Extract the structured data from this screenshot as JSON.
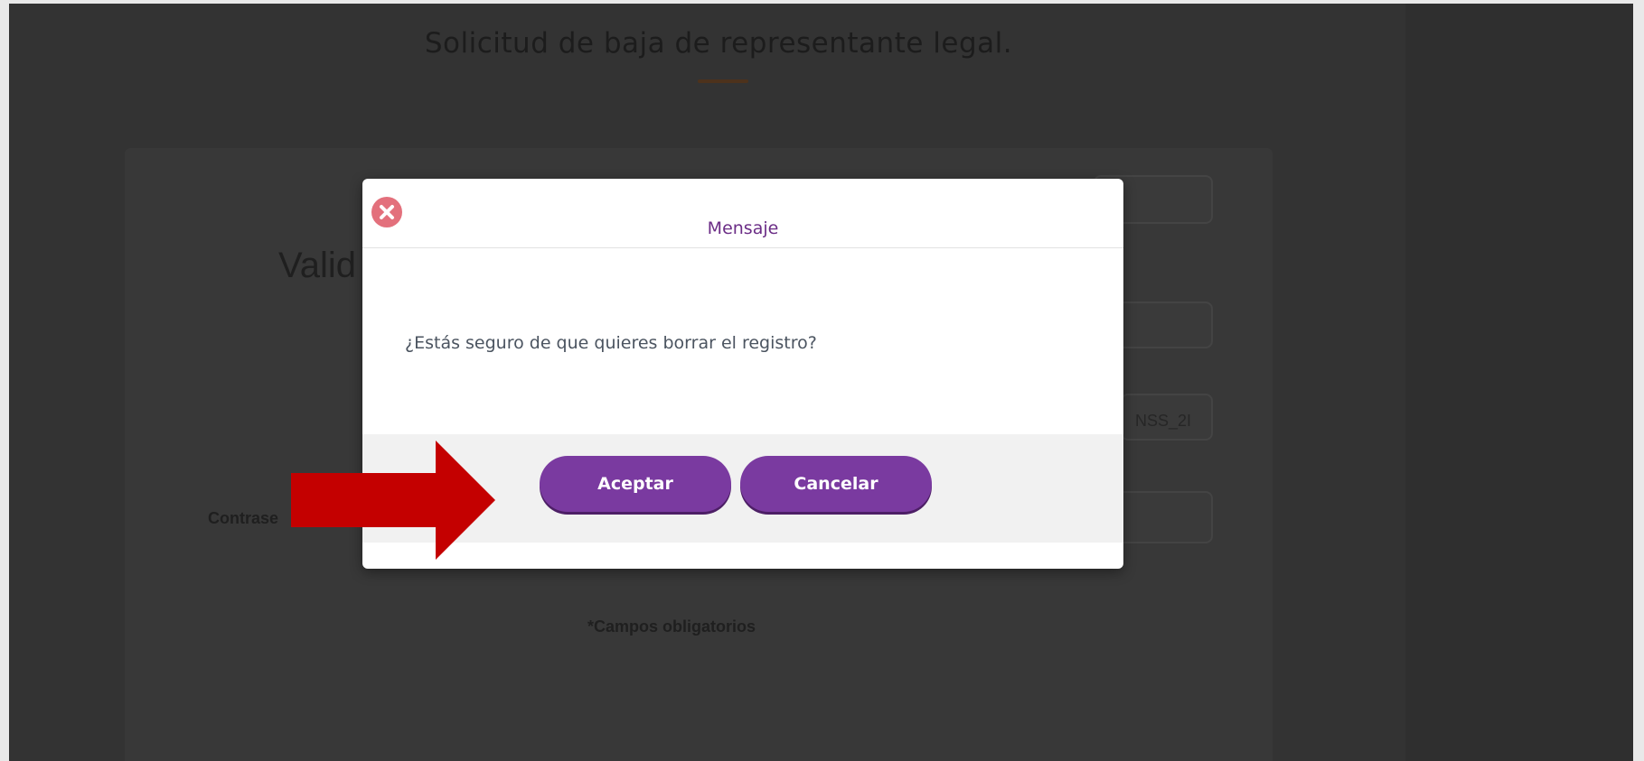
{
  "page": {
    "title": "Solicitud de baja de representante legal.",
    "background_heading": "Valid",
    "background_label": "Contrase",
    "background_field_text": "NSS_2I",
    "required_note": "*Campos obligatorios"
  },
  "modal": {
    "title": "Mensaje",
    "message": "¿Estás seguro de que quieres borrar el registro?",
    "accept_label": "Aceptar",
    "cancel_label": "Cancelar",
    "close_icon": "close-icon"
  },
  "annotation": {
    "icon": "red-arrow-icon",
    "color": "#c40000"
  },
  "colors": {
    "accent": "#7a3aa0",
    "title_color": "#6b2d86",
    "close_color": "#e3707c",
    "overlay": "#333333"
  }
}
